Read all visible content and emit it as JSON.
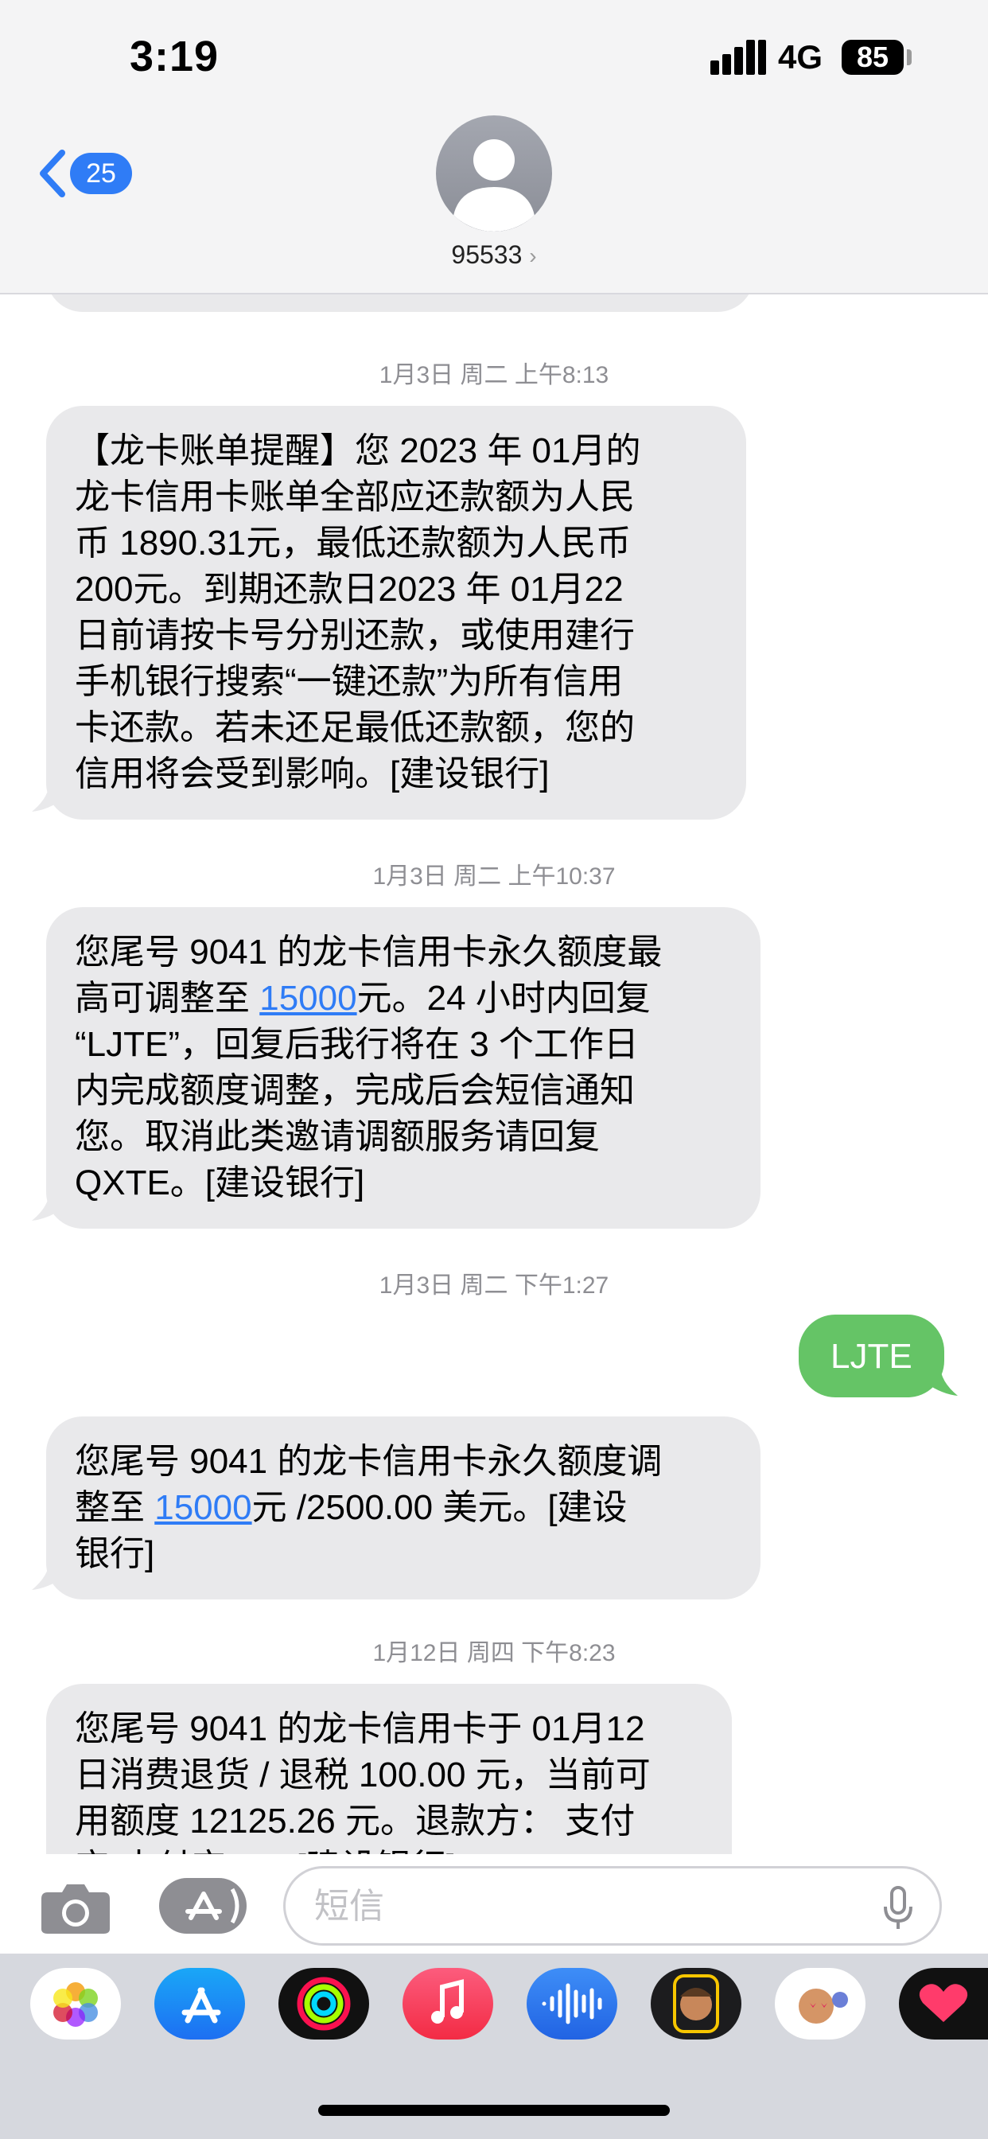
{
  "status_bar": {
    "time": "3:19",
    "network": "4G",
    "battery": "85"
  },
  "header": {
    "back_badge": "25",
    "contact_name": "95533",
    "contact_chevron": "›"
  },
  "messages": [
    {
      "timestamp": "1月3日 周二 上午8:13",
      "direction": "incoming",
      "lines": [
        "【龙卡账单提醒】您 2023 年 01月的",
        "龙卡信用卡账单全部应还款额为人民",
        "币 1890.31元，最低还款额为人民币",
        "200元。到期还款日2023 年 01月22",
        "日前请按卡号分别还款，或使用建行",
        "手机银行搜索“一键还款”为所有信用",
        "卡还款。若未还足最低还款额，您的",
        "信用将会受到影响。[建设银行]"
      ]
    },
    {
      "timestamp": "1月3日 周二 上午10:37",
      "direction": "incoming",
      "line1": "您尾号 9041 的龙卡信用卡永久额度最",
      "line2_pre": "高可调整至 ",
      "line2_link": "15000",
      "line2_post": "元。24 小时内回复",
      "lines_rest": [
        "“LJTE”，回复后我行将在 3 个工作日",
        "内完成额度调整，完成后会短信通知",
        "您。取消此类邀请调额服务请回复",
        "QXTE。[建设银行]"
      ]
    },
    {
      "timestamp": "1月3日 周二 下午1:27",
      "direction": "outgoing",
      "text": "LJTE"
    },
    {
      "direction": "incoming",
      "line1": "您尾号 9041 的龙卡信用卡永久额度调",
      "line2_pre": "整至 ",
      "line2_link": "15000",
      "line2_post": "元 /2500.00 美元。[建设",
      "line3": "银行]"
    },
    {
      "timestamp": "1月12日 周四 下午8:23",
      "direction": "incoming",
      "lines": [
        "您尾号 9041 的龙卡信用卡于 01月12",
        "日消费退货 / 退税 100.00 元，当前可",
        "用额度 12125.26 元。退款方： 支付",
        "宝-支付宝……[建设银行]"
      ]
    }
  ],
  "input": {
    "placeholder": "短信"
  },
  "app_tray": [
    "photos-icon",
    "app-store-icon",
    "activity-icon",
    "music-icon",
    "audio-message-icon",
    "memoji-icon",
    "memoji-stickers-icon",
    "digital-touch-icon"
  ],
  "colors": {
    "accent": "#2f7cf6",
    "outgoing_bubble": "#65c466",
    "incoming_bubble": "#e9e9eb"
  }
}
